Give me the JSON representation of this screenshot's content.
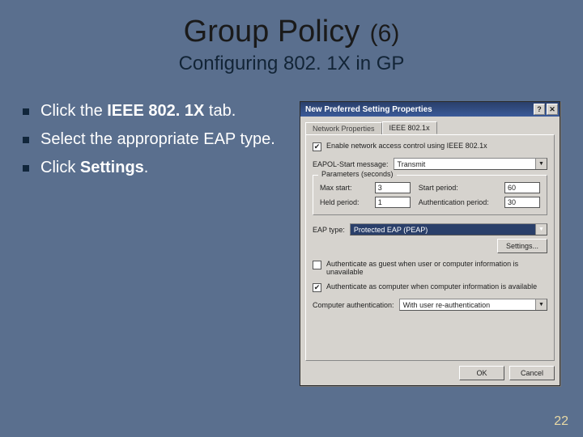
{
  "title": {
    "main": "Group Policy",
    "paren": "(6)"
  },
  "subtitle": "Configuring 802. 1X in GP",
  "bullets": [
    {
      "pre": "Click the ",
      "bold": "IEEE 802. 1X",
      "post": " tab."
    },
    {
      "pre": "Select the appropriate EAP type.",
      "bold": "",
      "post": ""
    },
    {
      "pre": "Click ",
      "bold": "Settings",
      "post": "."
    }
  ],
  "dialog": {
    "title": "New Preferred Setting Properties",
    "winbtns": {
      "help": "?",
      "close": "✕"
    },
    "tabs": {
      "t1": "Network Properties",
      "t2": "IEEE 802.1x"
    },
    "enable": "Enable network access control using IEEE 802.1x",
    "eapol_label": "EAPOL-Start message:",
    "eapol_value": "Transmit",
    "params_legend": "Parameters (seconds)",
    "max_start_label": "Max start:",
    "max_start_value": "3",
    "start_period_label": "Start period:",
    "start_period_value": "60",
    "held_period_label": "Held period:",
    "held_period_value": "1",
    "auth_period_label": "Authentication period:",
    "auth_period_value": "30",
    "eap_type_label": "EAP type:",
    "eap_type_value": "Protected EAP (PEAP)",
    "settings_btn": "Settings...",
    "guest_chk": "Authenticate as guest when user or computer information is unavailable",
    "comp_chk": "Authenticate as computer when computer information is available",
    "comp_auth_label": "Computer authentication:",
    "comp_auth_value": "With user re-authentication",
    "ok": "OK",
    "cancel": "Cancel"
  },
  "slidenum": "22"
}
